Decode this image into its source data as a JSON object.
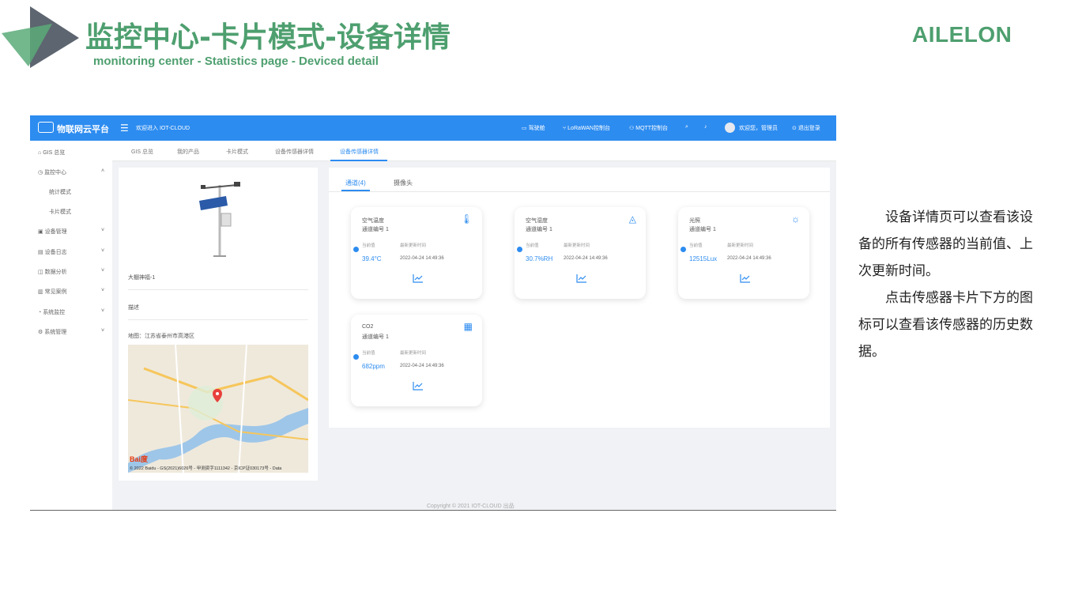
{
  "slide": {
    "title": "监控中心-卡片模式-设备详情",
    "subtitle": "monitoring center - Statistics page - Deviced detail",
    "brand": "AILELON",
    "accent_color": "#4e9f6f",
    "description": [
      "设备详情页可以查看该设备的所有传感器的当前值、上次更新时间。",
      "点击传感器卡片下方的图标可以查看该传感器的历史数据。"
    ]
  },
  "app": {
    "name": "物联网云平台",
    "welcome": "欢迎进入 IOT-CLOUD",
    "primary_color": "#2d8cf0",
    "topbar_items": {
      "screen": "驾驶舱",
      "lorawan": "LoRaWAN控制台",
      "mqtt": "MQTT控制台",
      "user": "欢迎您，管理员",
      "logout": "退出登录"
    },
    "sidebar": {
      "items": [
        {
          "label": "GIS 总览",
          "icon": "home-icon"
        },
        {
          "label": "监控中心",
          "icon": "monitor-icon"
        },
        {
          "label": "设备管理",
          "icon": "device-icon"
        },
        {
          "label": "设备日志",
          "icon": "log-icon"
        },
        {
          "label": "数据分析",
          "icon": "chart-icon"
        },
        {
          "label": "常见案例",
          "icon": "case-icon"
        },
        {
          "label": "系统监控",
          "icon": "system-monitor-icon"
        },
        {
          "label": "系统管理",
          "icon": "settings-icon"
        }
      ],
      "sub_items": [
        "统计模式",
        "卡片模式"
      ]
    },
    "tabs": [
      "GIS 总览",
      "我的产品",
      "卡片模式",
      "设备传感器详情",
      "设备传感器详情"
    ],
    "active_tab_index": 4,
    "device": {
      "name": "大棚神福-1",
      "desc_label": "描述",
      "address": "地图：江苏省泰州市高港区"
    },
    "map": {
      "copyright": "© 2022 Baidu - GS(2021)6026号 - 甲测资字1111342 - 京ICP证030173号 - Data",
      "logo": "Bai度"
    },
    "panel_tabs": [
      "通道(4)",
      "摄像头"
    ],
    "card_labels": {
      "current": "当前值",
      "updated": "最新更新时间"
    },
    "sensors": [
      {
        "name": "空气温度",
        "channel": "通道编号 1",
        "value": "39.4°C",
        "time": "2022-04-24 14:49:36",
        "icon": "thermometer-icon"
      },
      {
        "name": "空气湿度",
        "channel": "通道编号 1",
        "value": "30.7%RH",
        "time": "2022-04-24 14:49:36",
        "icon": "humidity-icon"
      },
      {
        "name": "光照",
        "channel": "通道编号 1",
        "value": "12515Lux",
        "time": "2022-04-24 14:49:36",
        "icon": "sun-icon"
      },
      {
        "name": "CO2",
        "channel": "通道编号 1",
        "value": "682ppm",
        "time": "2022-04-24 14:49:36",
        "icon": "co2-icon"
      }
    ],
    "copyright": "Copyright © 2021 IOT-CLOUD 出品"
  }
}
